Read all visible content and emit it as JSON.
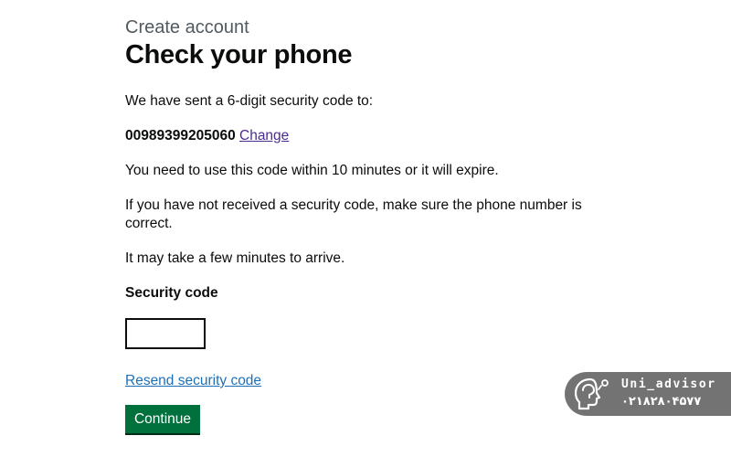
{
  "header": {
    "caption": "Create account",
    "title": "Check your phone"
  },
  "body": {
    "sent_text": "We have sent a 6-digit security code to:",
    "phone_number": "00989399205060",
    "change_link": "Change",
    "expire_text": "You need to use this code within 10 minutes or it will expire.",
    "not_received_text": "If you have not received a security code, make sure the phone number is correct.",
    "arrive_text": "It may take a few minutes to arrive."
  },
  "form": {
    "code_label": "Security code",
    "code_value": "",
    "resend_link": "Resend security code",
    "continue_label": "Continue"
  },
  "watermark": {
    "name": "Uni_advisor",
    "phone": "۰۲۱۸۲۸۰۴۵۷۷",
    "icon": "head-silhouette-icon"
  },
  "colors": {
    "text": "#0b0c0c",
    "caption": "#505a5f",
    "link": "#1d70b8",
    "visited_link": "#4c2c92",
    "button": "#00703c",
    "button_shadow": "#002d18"
  }
}
